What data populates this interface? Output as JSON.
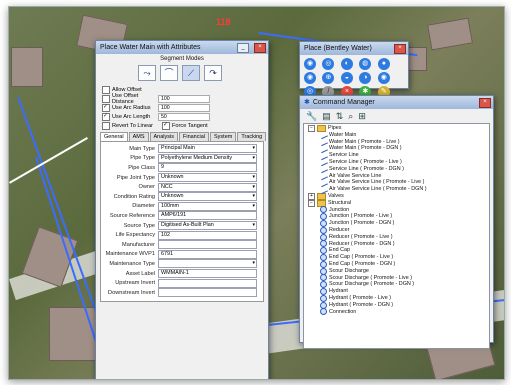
{
  "map": {
    "label_top": "118"
  },
  "place_water_main": {
    "title": "Place Water Main with Attributes",
    "segment_modes_label": "Segment Modes",
    "options": [
      {
        "label": "Allow Offset",
        "checked": false,
        "value": ""
      },
      {
        "label": "Use Offset Distance",
        "checked": false,
        "value": "100"
      },
      {
        "label": "Use Arc Radius",
        "checked": true,
        "value": "100"
      },
      {
        "label": "Use Arc Length",
        "checked": true,
        "value": "50"
      }
    ],
    "revert_to_linear": "Revert To Linear",
    "force_tangent": "Force Tangent",
    "tabs": [
      "General",
      "AMS",
      "Analysis",
      "Financial",
      "System",
      "Tracking"
    ],
    "fields": [
      {
        "label": "Main Type",
        "value": "Principal Main",
        "dropdown": true
      },
      {
        "label": "Pipe Type",
        "value": "Polyethylene Medium Density",
        "dropdown": true
      },
      {
        "label": "Pipe Class",
        "value": "9",
        "dropdown": false
      },
      {
        "label": "Pipe Joint Type",
        "value": "Unknown",
        "dropdown": true
      },
      {
        "label": "Owner",
        "value": "NCC",
        "dropdown": true
      },
      {
        "label": "Condition Rating",
        "value": "Unknown",
        "dropdown": true
      },
      {
        "label": "Diameter",
        "value": "100mm",
        "dropdown": true
      },
      {
        "label": "Source Reference",
        "value": "AMP6/191",
        "dropdown": false
      },
      {
        "label": "Source Type",
        "value": "Digitised As-Built Plan",
        "dropdown": true
      },
      {
        "label": "Life Expectancy",
        "value": "102",
        "dropdown": false
      },
      {
        "label": "Manufacturer",
        "value": "",
        "dropdown": false
      },
      {
        "label": "Maintenance WVP1",
        "value": "6791",
        "dropdown": false
      },
      {
        "label": "Maintenance Type",
        "value": "",
        "dropdown": true
      },
      {
        "label": "Asset Label",
        "value": "WMMAIN-1",
        "dropdown": false
      },
      {
        "label": "Upstream Invert",
        "value": "",
        "dropdown": false
      },
      {
        "label": "Downstream Invert",
        "value": "",
        "dropdown": false
      }
    ]
  },
  "place_bentley_water": {
    "title": "Place (Bentley Water)"
  },
  "command_manager": {
    "title": "Command Manager",
    "tree": [
      {
        "level": 0,
        "kind": "folder",
        "label": "Pipes",
        "expanded": true
      },
      {
        "level": 1,
        "kind": "pipe",
        "label": "Water Main"
      },
      {
        "level": 1,
        "kind": "pipe",
        "label": "Water Main ( Promote - Live )"
      },
      {
        "level": 1,
        "kind": "pipe",
        "label": "Water Main ( Promote - DGN )"
      },
      {
        "level": 1,
        "kind": "pipe",
        "label": "Service Line"
      },
      {
        "level": 1,
        "kind": "pipe",
        "label": "Service Line ( Promote - Live )"
      },
      {
        "level": 1,
        "kind": "pipe",
        "label": "Service Line ( Promote - DGN )"
      },
      {
        "level": 1,
        "kind": "pipe",
        "label": "Air Valve Service Line"
      },
      {
        "level": 1,
        "kind": "pipe",
        "label": "Air Valve Service Line ( Promote - Live )"
      },
      {
        "level": 1,
        "kind": "pipe",
        "label": "Air Valve Service Line ( Promote - DGN )"
      },
      {
        "level": 0,
        "kind": "folder",
        "label": "Valves",
        "expanded": false
      },
      {
        "level": 0,
        "kind": "folder",
        "label": "Structural",
        "expanded": true
      },
      {
        "level": 1,
        "kind": "node",
        "label": "Junction"
      },
      {
        "level": 1,
        "kind": "node",
        "label": "Junction ( Promote - Live )"
      },
      {
        "level": 1,
        "kind": "node",
        "label": "Junction ( Promote - DGN )"
      },
      {
        "level": 1,
        "kind": "node",
        "label": "Reducer"
      },
      {
        "level": 1,
        "kind": "node",
        "label": "Reducer ( Promote - Live )"
      },
      {
        "level": 1,
        "kind": "node",
        "label": "Reducer ( Promote - DGN )"
      },
      {
        "level": 1,
        "kind": "node",
        "label": "End Cap"
      },
      {
        "level": 1,
        "kind": "node",
        "label": "End Cap ( Promote - Live )"
      },
      {
        "level": 1,
        "kind": "node",
        "label": "End Cap ( Promote - DGN )"
      },
      {
        "level": 1,
        "kind": "node",
        "label": "Scour Discharge"
      },
      {
        "level": 1,
        "kind": "node",
        "label": "Scour Discharge ( Promote - Live )"
      },
      {
        "level": 1,
        "kind": "node",
        "label": "Scour Discharge ( Promote - DGN )"
      },
      {
        "level": 1,
        "kind": "node",
        "label": "Hydrant"
      },
      {
        "level": 1,
        "kind": "node",
        "label": "Hydrant ( Promote - Live )"
      },
      {
        "level": 1,
        "kind": "node",
        "label": "Hydrant ( Promote - DGN )"
      },
      {
        "level": 1,
        "kind": "node",
        "label": "Connection"
      }
    ]
  }
}
